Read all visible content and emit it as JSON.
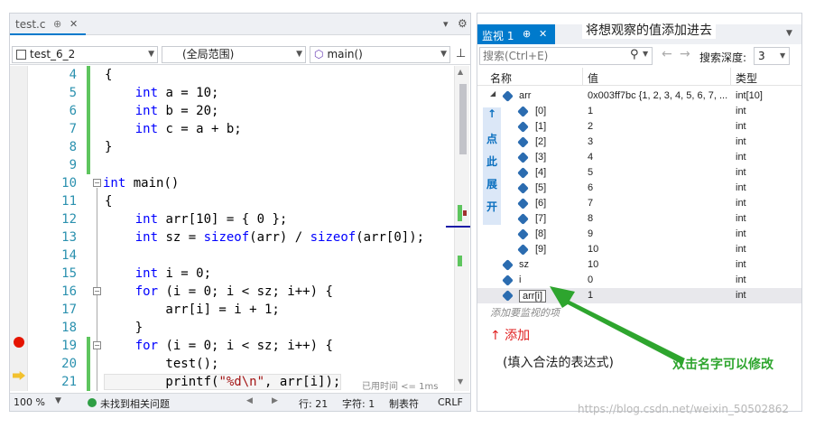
{
  "editor": {
    "tab_label": "test.c",
    "tab_pin": "⊕",
    "tab_close": "✕",
    "tab_menu": "▾",
    "tab_gear": "⚙",
    "nav": {
      "project": "test_6_2",
      "scope": "(全局范围)",
      "function": "main()"
    },
    "lines": [
      {
        "no": "4",
        "text": "{"
      },
      {
        "no": "5",
        "text": "    int a = 10;"
      },
      {
        "no": "6",
        "text": "    int b = 20;"
      },
      {
        "no": "7",
        "text": "    int c = a + b;"
      },
      {
        "no": "8",
        "text": "}"
      },
      {
        "no": "9",
        "text": ""
      },
      {
        "no": "10",
        "text": "int main()"
      },
      {
        "no": "11",
        "text": "{"
      },
      {
        "no": "12",
        "text": "    int arr[10] = { 0 };"
      },
      {
        "no": "13",
        "text": "    int sz = sizeof(arr) / sizeof(arr[0]);"
      },
      {
        "no": "14",
        "text": ""
      },
      {
        "no": "15",
        "text": "    int i = 0;"
      },
      {
        "no": "16",
        "text": "    for (i = 0; i < sz; i++) {"
      },
      {
        "no": "17",
        "text": "        arr[i] = i + 1;"
      },
      {
        "no": "18",
        "text": "    }"
      },
      {
        "no": "19",
        "text": "    for (i = 0; i < sz; i++) {"
      },
      {
        "no": "20",
        "text": "        test();"
      },
      {
        "no": "21",
        "text": "        printf(\"%d\\n\", arr[i]);"
      }
    ],
    "elapsed_hint": "已用时间 <= 1ms",
    "status": {
      "zoom": "100 %",
      "issues": "未找到相关问题",
      "line": "行: 21",
      "col": "字符: 1",
      "tabs": "制表符",
      "eol": "CRLF"
    }
  },
  "watch": {
    "tab_label": "监视 1",
    "tab_pin": "⊕",
    "tab_close": "✕",
    "header_note": "将想观察的值添加进去",
    "search_placeholder": "搜索(Ctrl+E)",
    "search_depth_label": "搜索深度:",
    "search_depth_value": "3",
    "columns": {
      "name": "名称",
      "value": "值",
      "type": "类型"
    },
    "rows": [
      {
        "name": "arr",
        "value": "0x003ff7bc {1, 2, 3, 4, 5, 6, 7, ...",
        "type": "int[10]"
      },
      {
        "name": "[0]",
        "value": "1",
        "type": "int"
      },
      {
        "name": "[1]",
        "value": "2",
        "type": "int"
      },
      {
        "name": "[2]",
        "value": "3",
        "type": "int"
      },
      {
        "name": "[3]",
        "value": "4",
        "type": "int"
      },
      {
        "name": "[4]",
        "value": "5",
        "type": "int"
      },
      {
        "name": "[5]",
        "value": "6",
        "type": "int"
      },
      {
        "name": "[6]",
        "value": "7",
        "type": "int"
      },
      {
        "name": "[7]",
        "value": "8",
        "type": "int"
      },
      {
        "name": "[8]",
        "value": "9",
        "type": "int"
      },
      {
        "name": "[9]",
        "value": "10",
        "type": "int"
      },
      {
        "name": "sz",
        "value": "10",
        "type": "int"
      },
      {
        "name": "i",
        "value": "0",
        "type": "int"
      },
      {
        "name": "arr[i]",
        "value": "1",
        "type": "int"
      }
    ],
    "add_placeholder": "添加要监视的项",
    "annot_expand": [
      "↑",
      "点",
      "此",
      "展",
      "开"
    ],
    "annot_add": "↑ 添加",
    "annot_legal": "(填入合法的表达式)",
    "annot_dblclick": "双击名字可以修改"
  },
  "watermark": "https://blog.csdn.net/weixin_50502862"
}
